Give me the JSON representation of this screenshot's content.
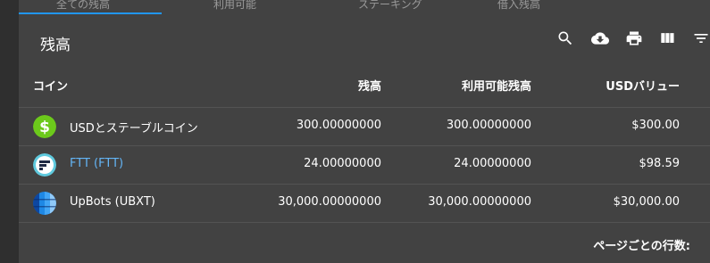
{
  "tabs": [
    {
      "label": "全ての残高"
    },
    {
      "label": "利用可能"
    },
    {
      "label": "ステーキング"
    },
    {
      "label": "借入残高"
    }
  ],
  "page_title": "残高",
  "toolbar": {
    "icons": [
      "search-icon",
      "download-icon",
      "print-icon",
      "columns-icon",
      "filter-icon"
    ]
  },
  "table": {
    "headers": {
      "coin": "コイン",
      "balance": "残高",
      "available": "利用可能残高",
      "usd_value": "USDバリュー"
    },
    "rows": [
      {
        "name": "USDとステーブルコイン",
        "balance": "300.00000000",
        "available": "300.00000000",
        "usd": "$300.00",
        "icon": "dollar-coin-icon",
        "link": false
      },
      {
        "name": "FTT (FTT)",
        "balance": "24.00000000",
        "available": "24.00000000",
        "usd": "$98.59",
        "icon": "ftt-coin-icon",
        "link": true
      },
      {
        "name": "UpBots (UBXT)",
        "balance": "30,000.00000000",
        "available": "30,000.00000000",
        "usd": "$30,000.00",
        "icon": "ubxt-coin-icon",
        "link": false
      }
    ]
  },
  "footer": {
    "rows_per_page_label": "ページごとの行数:"
  },
  "colors": {
    "accent": "#2196f3",
    "link": "#64b5f6",
    "panel": "#424242",
    "background": "#2f2f2f"
  }
}
